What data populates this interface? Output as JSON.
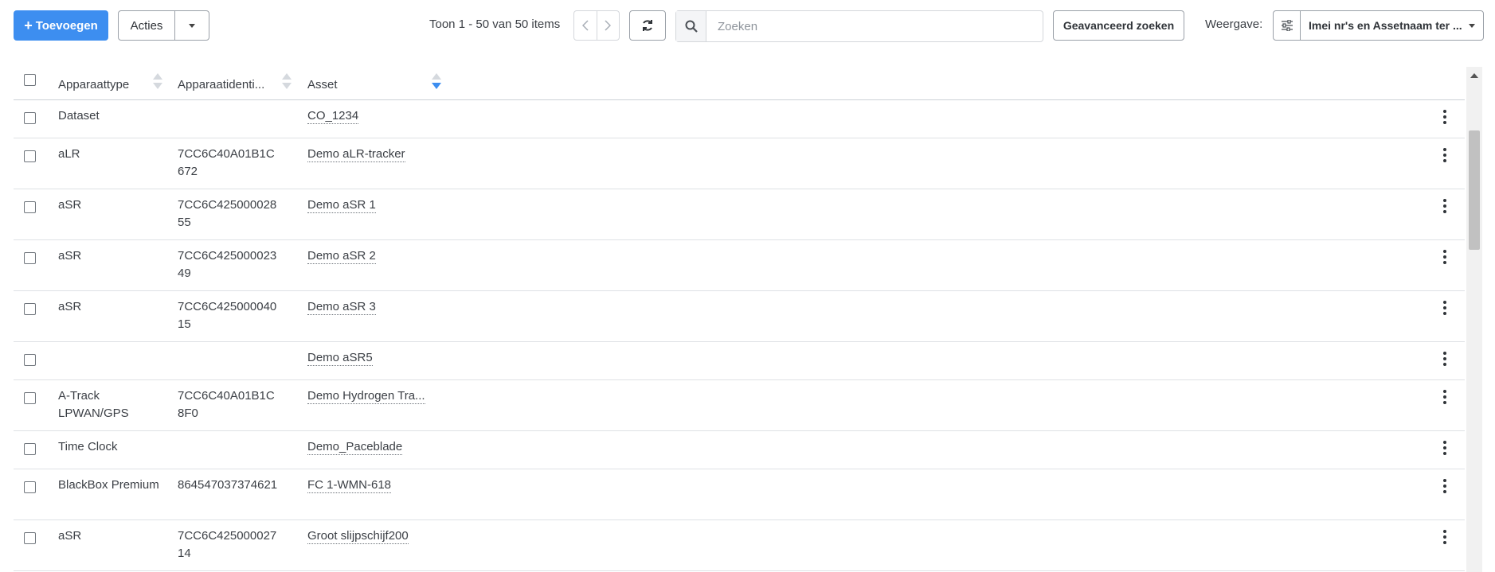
{
  "toolbar": {
    "add_label": "Toevoegen",
    "actions_label": "Acties",
    "paging_text": "Toon 1 - 50 van 50 items",
    "search_placeholder": "Zoeken",
    "advanced_search_label": "Geavanceerd zoeken",
    "view_label": "Weergave:",
    "view_selected": "Imei nr's en Assetnaam ter ..."
  },
  "colors": {
    "primary": "#3d8ef0",
    "sort_active": "#3d8ef0"
  },
  "table": {
    "columns": [
      "Apparaattype",
      "Apparaatidenti...",
      "Asset"
    ],
    "rows": [
      {
        "type": "Dataset",
        "id": "",
        "asset": "CO_1234"
      },
      {
        "type": "aLR",
        "id": "7CC6C40A01B1C672",
        "asset": "Demo aLR-tracker"
      },
      {
        "type": "aSR",
        "id": "7CC6C42500002855",
        "asset": "Demo aSR 1"
      },
      {
        "type": "aSR",
        "id": "7CC6C42500002349",
        "asset": "Demo aSR 2"
      },
      {
        "type": "aSR",
        "id": "7CC6C42500004015",
        "asset": "Demo aSR 3"
      },
      {
        "type": "",
        "id": "",
        "asset": "Demo aSR5"
      },
      {
        "type": "A-Track LPWAN/GPS",
        "id": "7CC6C40A01B1C8F0",
        "asset": "Demo Hydrogen Tra..."
      },
      {
        "type": "Time Clock",
        "id": "",
        "asset": "Demo_Paceblade"
      },
      {
        "type": "BlackBox Premium",
        "id": "864547037374621",
        "asset": "FC 1-WMN-618"
      },
      {
        "type": "aSR",
        "id": "7CC6C42500002714",
        "asset": "Groot slijpschijf200"
      }
    ]
  }
}
